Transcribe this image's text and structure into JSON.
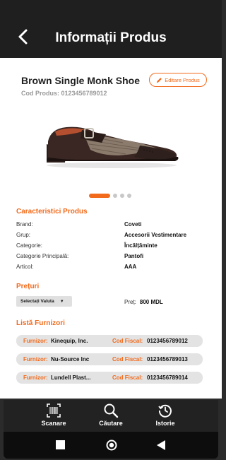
{
  "header": {
    "title": "Informații Produs"
  },
  "product": {
    "name": "Brown Single Monk Shoe",
    "code": "Cod Produs: 0123456789012",
    "edit_label": "Editare Produs"
  },
  "carousel": {
    "count": 4,
    "active": 0
  },
  "characteristics": {
    "title": "Caracteristici Produs",
    "rows": [
      {
        "key": "Brand:",
        "value": "Coveti"
      },
      {
        "key": "Grup:",
        "value": "Accesorii Vestimentare"
      },
      {
        "key": "Categorie:",
        "value": "Încălțăminte"
      },
      {
        "key": "Categorie Principală:",
        "value": "Pantofi"
      },
      {
        "key": "Articol:",
        "value": "AAA"
      }
    ]
  },
  "prices": {
    "title": "Prețuri",
    "currency_select": "Selectați Valuta",
    "price_label": "Preț:",
    "price_value": "800 MDL"
  },
  "suppliers": {
    "title": "Listă Furnizori",
    "supplier_label": "Furnizor:",
    "fiscal_label": "Cod Fiscal:",
    "items": [
      {
        "name": "Kinequip, Inc.",
        "fiscal": "0123456789012"
      },
      {
        "name": "Nu-Source Inc",
        "fiscal": "0123456789013"
      },
      {
        "name": "Lundell Plast...",
        "fiscal": "0123456789014"
      }
    ]
  },
  "tabs": [
    {
      "label": "Scanare",
      "icon": "barcode-scan-icon"
    },
    {
      "label": "Căutare",
      "icon": "search-icon"
    },
    {
      "label": "Istorie",
      "icon": "history-icon"
    }
  ],
  "system_nav": [
    "square-icon",
    "home-circle-icon",
    "back-triangle-icon"
  ],
  "colors": {
    "accent": "#f26a1b",
    "header_bg": "#1f1f1f",
    "tabbar_bg": "#222222"
  }
}
